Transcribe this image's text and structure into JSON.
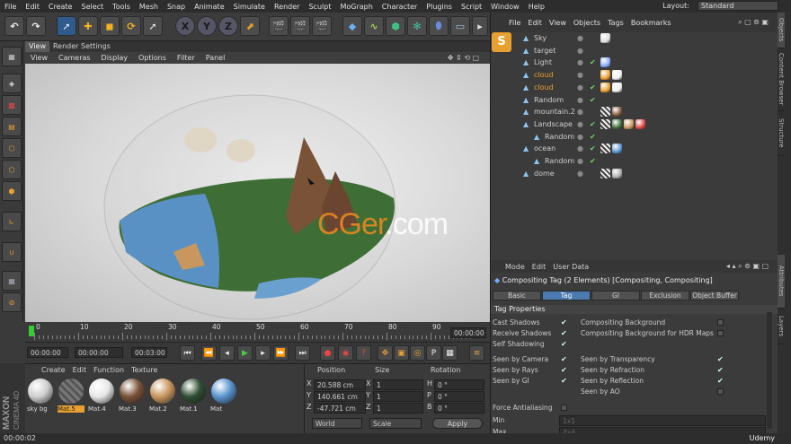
{
  "menu": [
    "File",
    "Edit",
    "Create",
    "Select",
    "Tools",
    "Mesh",
    "Snap",
    "Animate",
    "Simulate",
    "Render",
    "Sculpt",
    "MoGraph",
    "Character",
    "Plugins",
    "Script",
    "Window",
    "Help"
  ],
  "layout": {
    "label": "Layout:",
    "value": "Standard"
  },
  "viewport": {
    "tabs": [
      "View",
      "Render Settings"
    ],
    "menu": [
      "View",
      "Cameras",
      "Display",
      "Options",
      "Filter",
      "Panel"
    ],
    "watermark_main": "CGer",
    "watermark_tail": ".com"
  },
  "timeline": {
    "ticks": [
      "0",
      "10",
      "20",
      "30",
      "40",
      "50",
      "60",
      "70",
      "80",
      "90"
    ],
    "end_frame": "00:00:00"
  },
  "playback": {
    "current": "00:00:00",
    "start": "00:00:00",
    "end": "00:03:00"
  },
  "materials": {
    "menu": [
      "Create",
      "Edit",
      "Function",
      "Texture"
    ],
    "items": [
      {
        "name": "sky bg",
        "color": "#cfcfcf"
      },
      {
        "name": "Mat.5",
        "color": "#6a6a6a"
      },
      {
        "name": "Mat.4",
        "color": "#e8e8e8"
      },
      {
        "name": "Mat.3",
        "color": "#7a5238"
      },
      {
        "name": "Mat.2",
        "color": "#c9975e"
      },
      {
        "name": "Mat.1",
        "color": "#2f4f34"
      },
      {
        "name": "Mat",
        "color": "#5b95cf"
      }
    ]
  },
  "coords": {
    "headers": [
      "Position",
      "Size",
      "Rotation"
    ],
    "rows": [
      {
        "axis": "X",
        "pos": "20.588 cm",
        "size_axis": "X",
        "size": "1",
        "rot_axis": "H",
        "rot": "0 °"
      },
      {
        "axis": "Y",
        "pos": "140.661 cm",
        "size_axis": "Y",
        "size": "1",
        "rot_axis": "P",
        "rot": "0 °"
      },
      {
        "axis": "Z",
        "pos": "-47.721 cm",
        "size_axis": "Z",
        "size": "1",
        "rot_axis": "B",
        "rot": "0 °"
      }
    ],
    "world": "World",
    "scale": "Scale",
    "apply": "Apply"
  },
  "status": "00:00:02",
  "brand": {
    "maxon": "MAXON",
    "product": "CINEMA 4D"
  },
  "objects": {
    "menu": [
      "File",
      "Edit",
      "View",
      "Objects",
      "Tags",
      "Bookmarks"
    ],
    "rows": [
      {
        "name": "Sky",
        "orange": false,
        "indent": 0
      },
      {
        "name": "target",
        "orange": false,
        "indent": 0
      },
      {
        "name": "Light",
        "orange": false,
        "indent": 0
      },
      {
        "name": "cloud",
        "orange": true,
        "indent": 0
      },
      {
        "name": "cloud",
        "orange": true,
        "indent": 0
      },
      {
        "name": "Random",
        "orange": false,
        "indent": 0
      },
      {
        "name": "mountain.2",
        "orange": false,
        "indent": 0
      },
      {
        "name": "Landscape",
        "orange": false,
        "indent": 0
      },
      {
        "name": "Random",
        "orange": false,
        "indent": 1
      },
      {
        "name": "ocean",
        "orange": false,
        "indent": 0
      },
      {
        "name": "Random",
        "orange": false,
        "indent": 1
      },
      {
        "name": "dome",
        "orange": false,
        "indent": 0
      }
    ]
  },
  "attributes": {
    "menu": [
      "Mode",
      "Edit",
      "User Data"
    ],
    "title": "Compositing Tag (2 Elements) [Compositing, Compositing]",
    "tabs": [
      "Basic",
      "Tag",
      "GI",
      "Exclusion",
      "Object Buffer"
    ],
    "section": "Tag Properties",
    "left_props": [
      "Cast Shadows",
      "Receive Shadows",
      "Self Shadowing",
      "Seen by Camera",
      "Seen by Rays",
      "Seen by GI",
      "Force Antialiasing",
      "Min",
      "Max"
    ],
    "right_props": [
      "Compositing Background",
      "Compositing Background for HDR Maps",
      "Seen by Transparency",
      "Seen by Refraction",
      "Seen by Reflection",
      "Seen by AO"
    ],
    "min_value": "1x1",
    "max_value": "4x4"
  },
  "side_tabs": [
    "Objects",
    "Content Browser",
    "Structure",
    "Attributes",
    "Layers"
  ],
  "udemy": "Udemy"
}
